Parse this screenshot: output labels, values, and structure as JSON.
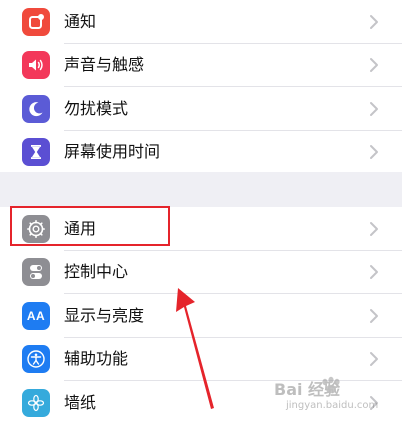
{
  "settings": {
    "group1": [
      {
        "label": "通知",
        "icon": "notification-icon",
        "color": "#f04a3c"
      },
      {
        "label": "声音与触感",
        "icon": "speaker-icon",
        "color": "#f3385a"
      },
      {
        "label": "勿扰模式",
        "icon": "moon-icon",
        "color": "#5b5bd6"
      },
      {
        "label": "屏幕使用时间",
        "icon": "hourglass-icon",
        "color": "#5b4fd3"
      }
    ],
    "group2": [
      {
        "label": "通用",
        "icon": "gear-icon",
        "color": "#8e8e93"
      },
      {
        "label": "控制中心",
        "icon": "toggle-icon",
        "color": "#8e8e93"
      },
      {
        "label": "显示与亮度",
        "icon": "text-size-icon",
        "color": "#1e7cf2"
      },
      {
        "label": "辅助功能",
        "icon": "accessibility-icon",
        "color": "#1e7cf2"
      },
      {
        "label": "墙纸",
        "icon": "flower-icon",
        "color": "#35aadc"
      }
    ],
    "text_size_glyph": "AA"
  },
  "annotation": {
    "highlight_color": "#e5242b",
    "highlighted_item": "通用"
  },
  "watermark": {
    "brand": "Bai 经验",
    "url": "jingyan.baidu.com"
  }
}
